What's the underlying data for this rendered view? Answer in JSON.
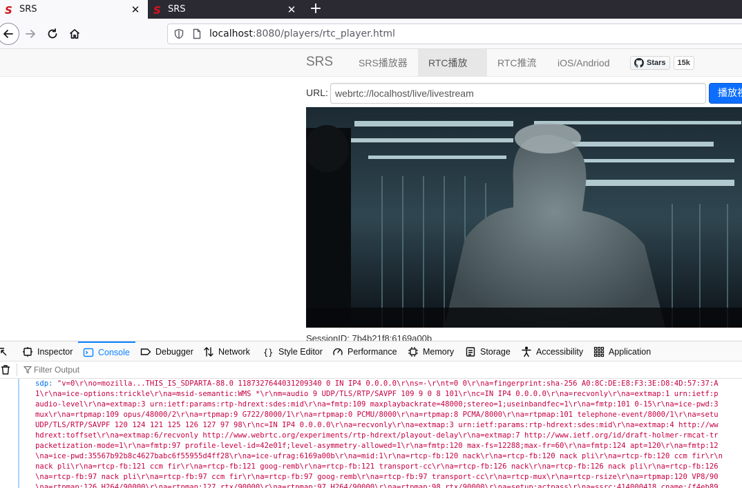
{
  "browser": {
    "tabs": [
      {
        "title": "SRS",
        "active": true
      },
      {
        "title": "SRS",
        "active": false
      }
    ],
    "url": {
      "host": "localhost",
      "rest": ":8080/players/rtc_player.html"
    }
  },
  "page": {
    "brand": "SRS",
    "nav": [
      {
        "label": "SRS播放器",
        "active": false
      },
      {
        "label": "RTC播放器",
        "active": true
      },
      {
        "label": "RTC推流",
        "active": false
      },
      {
        "label": "iOS/Andriod",
        "active": false
      }
    ],
    "github": {
      "stars_label": "Stars",
      "count": "15k"
    },
    "url_label": "URL:",
    "url_value": "webrtc://localhost/live/livestream",
    "play_button": "播放视",
    "session_text": "SessionID: 7b4b21f8:6169a00b"
  },
  "devtools": {
    "tabs": [
      {
        "label": "Inspector"
      },
      {
        "label": "Console",
        "selected": true
      },
      {
        "label": "Debugger"
      },
      {
        "label": "Network"
      },
      {
        "label": "Style Editor"
      },
      {
        "label": "Performance"
      },
      {
        "label": "Memory"
      },
      {
        "label": "Storage"
      },
      {
        "label": "Accessibility"
      },
      {
        "label": "Application"
      }
    ],
    "filter_placeholder": "Filter Output",
    "console": {
      "key": "sdp:",
      "lines": [
        "\"v=0\\r\\no=mozilla...THIS_IS_SDPARTA-88.0 1187327644031209340 0 IN IP4 0.0.0.0\\r\\ns=-\\r\\nt=0 0\\r\\na=fingerprint:sha-256 A0:8C:DE:E8:F3:3E:D8:4D:57:37:A",
        "1\\r\\na=ice-options:trickle\\r\\na=msid-semantic:WMS *\\r\\nm=audio 9 UDP/TLS/RTP/SAVPF 109 9 0 8 101\\r\\nc=IN IP4 0.0.0.0\\r\\na=recvonly\\r\\na=extmap:1 urn:ietf:p",
        "audio-level\\r\\na=extmap:3 urn:ietf:params:rtp-hdrext:sdes:mid\\r\\na=fmtp:109 maxplaybackrate=48000;stereo=1;useinbandfec=1\\r\\na=fmtp:101 0-15\\r\\na=ice-pwd:3",
        "mux\\r\\na=rtpmap:109 opus/48000/2\\r\\na=rtpmap:9 G722/8000/1\\r\\na=rtpmap:0 PCMU/8000\\r\\na=rtpmap:8 PCMA/8000\\r\\na=rtpmap:101 telephone-event/8000/1\\r\\na=setu",
        "UDP/TLS/RTP/SAVPF 120 124 121 125 126 127 97 98\\r\\nc=IN IP4 0.0.0.0\\r\\na=recvonly\\r\\na=extmap:3 urn:ietf:params:rtp-hdrext:sdes:mid\\r\\na=extmap:4 http://ww",
        "hdrext:toffset\\r\\na=extmap:6/recvonly http://www.webrtc.org/experiments/rtp-hdrext/playout-delay\\r\\na=extmap:7 http://www.ietf.org/id/draft-holmer-rmcat-tr",
        "packetization-mode=1\\r\\na=fmtp:97 profile-level-id=42e01f;level-asymmetry-allowed=1\\r\\na=fmtp:120 max-fs=12288;max-fr=60\\r\\na=fmtp:124 apt=120\\r\\na=fmtp:12",
        "\\na=ice-pwd:35567b92b8c4627babc6f55955d4ff28\\r\\na=ice-ufrag:6169a00b\\r\\na=mid:1\\r\\na=rtcp-fb:120 nack\\r\\na=rtcp-fb:120 nack pli\\r\\na=rtcp-fb:120 ccm fir\\r\\n",
        "nack pli\\r\\na=rtcp-fb:121 ccm fir\\r\\na=rtcp-fb:121 goog-remb\\r\\na=rtcp-fb:121 transport-cc\\r\\na=rtcp-fb:126 nack\\r\\na=rtcp-fb:126 nack pli\\r\\na=rtcp-fb:126",
        "\\na=rtcp-fb:97 nack pli\\r\\na=rtcp-fb:97 ccm fir\\r\\na=rtcp-fb:97 goog-remb\\r\\na=rtcp-fb:97 transport-cc\\r\\na=rtcp-mux\\r\\na=rtcp-rsize\\r\\na=rtpmap:120 VP8/90",
        "\\na=rtpmap:126 H264/90000\\r\\na=rtpmap:127 rtx/90000\\r\\na=rtpmap:97 H264/90000\\r\\na=rtpmap:98 rtx/90000\\r\\na=setup:actpass\\r\\na=ssrc:414000418 cname:{f4eb89"
      ]
    }
  },
  "colors": {
    "accent": "#0a84ff",
    "console_string": "#c50042",
    "play_button": "#0d6efd"
  }
}
